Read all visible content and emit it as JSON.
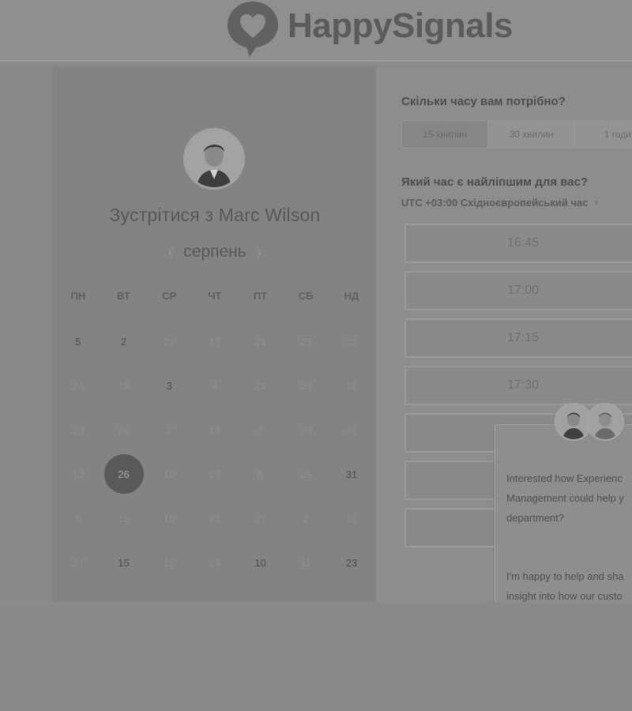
{
  "header": {
    "brand": "HappySignals"
  },
  "calendar": {
    "title": "Зустрітися з Marc Wilson",
    "month": "серпень",
    "weekdays": [
      "ПН",
      "ВТ",
      "СР",
      "ЧТ",
      "ПТ",
      "СБ",
      "НД"
    ],
    "days": [
      {
        "label": "5",
        "state": "avail"
      },
      {
        "label": "2",
        "state": "avail"
      },
      {
        "label": "29",
        "state": "dim"
      },
      {
        "label": "17",
        "state": "dim"
      },
      {
        "label": "25",
        "state": "dim"
      },
      {
        "label": "23",
        "state": "dim"
      },
      {
        "label": "25",
        "state": "dim"
      },
      {
        "label": "24",
        "state": "dim"
      },
      {
        "label": "19",
        "state": "dim"
      },
      {
        "label": "3",
        "state": "avail"
      },
      {
        "label": "4",
        "state": "dim"
      },
      {
        "label": "23",
        "state": "dim"
      },
      {
        "label": "28",
        "state": "dim"
      },
      {
        "label": "10",
        "state": "dim"
      },
      {
        "label": "20",
        "state": "dim"
      },
      {
        "label": "20",
        "state": "dim"
      },
      {
        "label": "2",
        "state": "dim"
      },
      {
        "label": "13",
        "state": "dim"
      },
      {
        "label": "2",
        "state": "dim"
      },
      {
        "label": "30",
        "state": "dim"
      },
      {
        "label": "30",
        "state": "dim"
      },
      {
        "label": "13",
        "state": "dim"
      },
      {
        "label": "26",
        "state": "selected"
      },
      {
        "label": "10",
        "state": "dim"
      },
      {
        "label": "27",
        "state": "dim"
      },
      {
        "label": "6",
        "state": "dim"
      },
      {
        "label": "25",
        "state": "dim"
      },
      {
        "label": "31",
        "state": "avail"
      },
      {
        "label": "5",
        "state": "dim"
      },
      {
        "label": "11",
        "state": "dim"
      },
      {
        "label": "10",
        "state": "dim"
      },
      {
        "label": "31",
        "state": "dim"
      },
      {
        "label": "27",
        "state": "dim"
      },
      {
        "label": "2",
        "state": "dim"
      },
      {
        "label": "10",
        "state": "dim"
      },
      {
        "label": "27",
        "state": "dim"
      },
      {
        "label": "15",
        "state": "avail"
      },
      {
        "label": "12",
        "state": "dim"
      },
      {
        "label": "24",
        "state": "dim"
      },
      {
        "label": "10",
        "state": "avail"
      },
      {
        "label": "11",
        "state": "dim"
      },
      {
        "label": "23",
        "state": "avail"
      }
    ]
  },
  "booking": {
    "duration_question": "Скільки часу вам потрібно?",
    "durations": [
      "15 хвилин",
      "30 хвилин",
      "1 годи"
    ],
    "time_question": "Який час є найліпшим для вас?",
    "timezone": "UTC +03:00 Східноєвропейський час",
    "slots": [
      "16:45",
      "17:00",
      "17:15",
      "17:30",
      "",
      "",
      ""
    ]
  },
  "chat": {
    "paragraphs": [
      "Interested how Experienc\nManagement could help y\ndepartment?",
      "I'm happy to help and sha\ninsight into how our custo\nuse our platform to achiev\nimprovement in IT end-us\nproductivity."
    ]
  }
}
